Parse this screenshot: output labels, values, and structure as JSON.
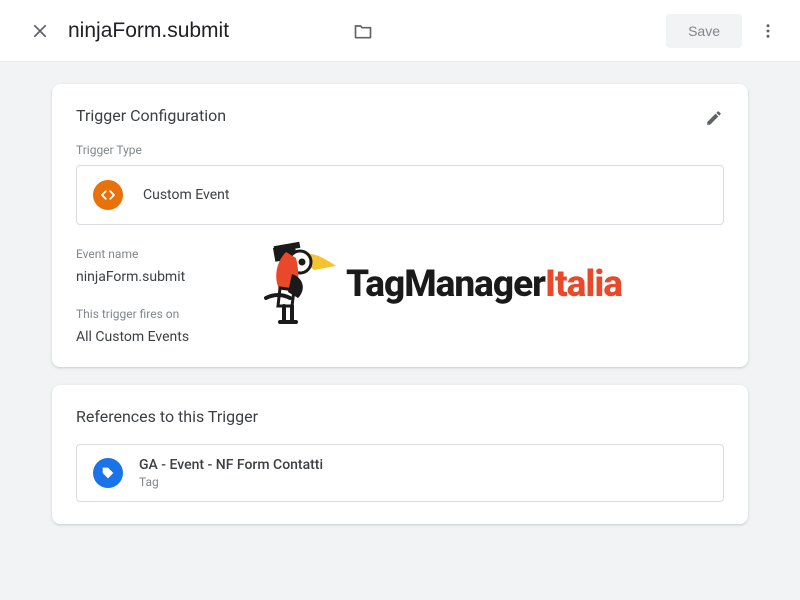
{
  "topbar": {
    "title": "ninjaForm.submit",
    "save_label": "Save"
  },
  "trigger_card": {
    "title": "Trigger Configuration",
    "type_label": "Trigger Type",
    "type_name": "Custom Event",
    "event_label": "Event name",
    "event_name": "ninjaForm.submit",
    "fires_label": "This trigger fires on",
    "fires_value": "All Custom Events"
  },
  "refs_card": {
    "title": "References to this Trigger",
    "items": [
      {
        "name": "GA - Event - NF Form Contatti",
        "type": "Tag"
      }
    ]
  },
  "watermark": {
    "part1": "TagManager",
    "part2": "Italia"
  }
}
